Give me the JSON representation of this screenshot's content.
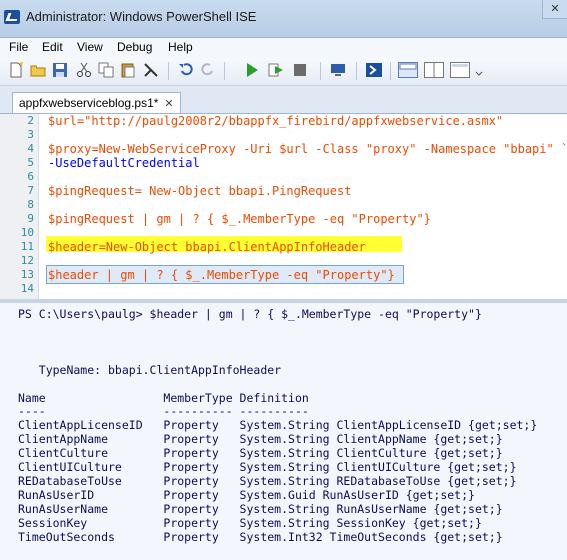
{
  "window": {
    "title": "Administrator: Windows PowerShell ISE"
  },
  "menu": {
    "items": [
      "File",
      "Edit",
      "View",
      "Debug",
      "Help"
    ]
  },
  "tab": {
    "label": "appfxwebserviceblog.ps1*",
    "close": "✕"
  },
  "editor": {
    "line_numbers": [
      "2",
      "3",
      "4",
      "5",
      "6",
      "7",
      "8",
      "9",
      "10",
      "11",
      "12",
      "13",
      "14"
    ],
    "lines": {
      "l2": "$url=\"http://paulg2008r2/bbappfx_firebird/appfxwebservice.asmx\"",
      "l4a": "$proxy=New-WebServiceProxy -Uri $url -Class \"proxy\" -Namespace \"bbapi\" `",
      "l4b": "-UseDefaultCredential",
      "l6": "$pingRequest= New-Object bbapi.PingRequest",
      "l8": "$pingRequest | gm | ? { $_.MemberType -eq \"Property\"}",
      "l11": "$header=New-Object bbapi.ClientAppInfoHeader",
      "l13": "$header | gm | ? { $_.MemberType -eq \"Property\"}"
    }
  },
  "console": {
    "prompt": "PS C:\\Users\\paulg> $header | gm | ? { $_.MemberType -eq \"Property\"}",
    "typename": "   TypeName: bbapi.ClientAppInfoHeader",
    "header": "Name                 MemberType Definition",
    "divider": "----                 ---------- ----------",
    "rows": [
      "ClientAppLicenseID   Property   System.String ClientAppLicenseID {get;set;}",
      "ClientAppName        Property   System.String ClientAppName {get;set;}",
      "ClientCulture        Property   System.String ClientCulture {get;set;}",
      "ClientUICulture      Property   System.String ClientUICulture {get;set;}",
      "REDatabaseToUse      Property   System.String REDatabaseToUse {get;set;}",
      "RunAsUserID          Property   System.Guid RunAsUserID {get;set;}",
      "RunAsUserName        Property   System.String RunAsUserName {get;set;}",
      "SessionKey           Property   System.String SessionKey {get;set;}",
      "TimeOutSeconds       Property   System.Int32 TimeOutSeconds {get;set;}"
    ]
  },
  "toolbar_icons": [
    "new-icon",
    "open-icon",
    "save-icon",
    "cut-icon",
    "copy-icon",
    "paste-icon",
    "clear-icon",
    "undo-icon",
    "redo-icon",
    "run-icon",
    "run-selection-icon",
    "stop-icon",
    "remote-icon",
    "powershell-icon",
    "layout-top-icon",
    "layout-right-icon",
    "layout-max-icon"
  ],
  "colors": {
    "variable": "#f04a00",
    "command": "#0000ff",
    "string": "#8b0000",
    "operator": "#a9a9a9",
    "highlight": "#ffff33",
    "console_bg": "#f3f7fd"
  }
}
